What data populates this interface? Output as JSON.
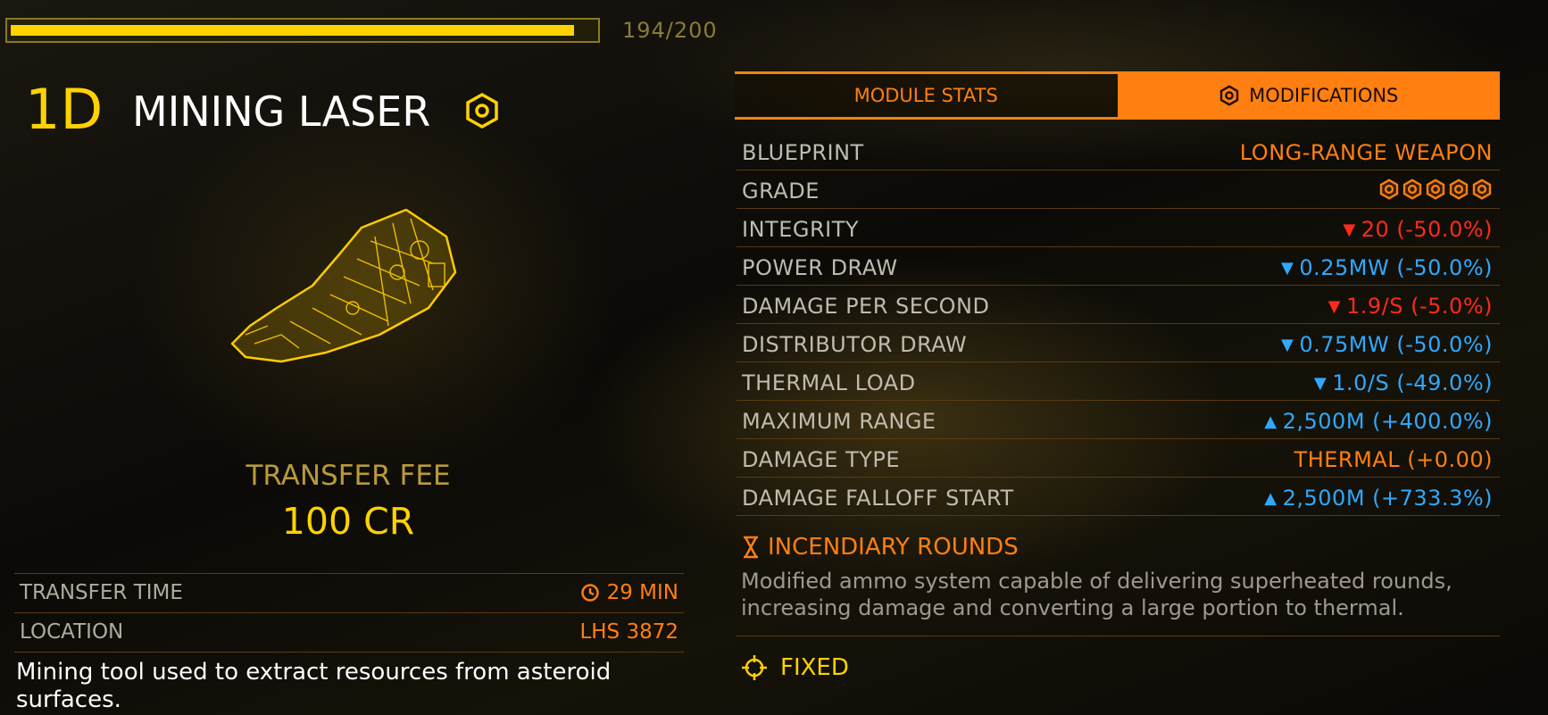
{
  "integrity_bar": {
    "value": 194,
    "max": 200,
    "label": "194/200",
    "fill_fraction": 0.97,
    "color": "#ffd200"
  },
  "module": {
    "class": "1D",
    "name": "MINING LASER",
    "engineered_icon": "engineering-hex-icon",
    "art_icon": "mining-laser-hologram"
  },
  "transfer": {
    "fee_label": "TRANSFER FEE",
    "fee_value": "100 CR",
    "rows": [
      {
        "label": "TRANSFER TIME",
        "value": "29 MIN",
        "icon": "clock-icon"
      },
      {
        "label": "LOCATION",
        "value": "LHS 3872"
      }
    ]
  },
  "description": "Mining tool used to extract resources from asteroid surfaces.",
  "tabs": [
    {
      "label": "MODULE STATS",
      "active": false
    },
    {
      "label": "MODIFICATIONS",
      "active": true,
      "icon": "engineering-hex-icon"
    }
  ],
  "stats": [
    {
      "label": "BLUEPRINT",
      "value": "LONG-RANGE WEAPON",
      "color": "orange"
    },
    {
      "label": "GRADE",
      "value": "",
      "grade": 5,
      "color": "orange"
    },
    {
      "label": "INTEGRITY",
      "value": "20 (-50.0%)",
      "arrow": "down",
      "color": "red"
    },
    {
      "label": "POWER DRAW",
      "value": "0.25MW (-50.0%)",
      "arrow": "down",
      "color": "blue"
    },
    {
      "label": "DAMAGE PER SECOND",
      "value": "1.9/S (-5.0%)",
      "arrow": "down",
      "color": "red"
    },
    {
      "label": "DISTRIBUTOR DRAW",
      "value": "0.75MW (-50.0%)",
      "arrow": "down",
      "color": "blue"
    },
    {
      "label": "THERMAL LOAD",
      "value": "1.0/S (-49.0%)",
      "arrow": "down",
      "color": "blue"
    },
    {
      "label": "MAXIMUM RANGE",
      "value": "2,500M (+400.0%)",
      "arrow": "up",
      "color": "blue"
    },
    {
      "label": "DAMAGE TYPE",
      "value": "THERMAL (+0.00)",
      "color": "orange"
    },
    {
      "label": "DAMAGE FALLOFF START",
      "value": "2,500M (+733.3%)",
      "arrow": "up",
      "color": "blue"
    }
  ],
  "special_effect": {
    "title": "INCENDIARY ROUNDS",
    "icon": "experimental-effect-icon",
    "description": "Modified ammo system capable of delivering superheated rounds, increasing damage and converting a large portion to thermal."
  },
  "mount": {
    "label": "FIXED",
    "icon": "crosshair-icon"
  },
  "colors": {
    "orange": "#ff7f10",
    "yellow": "#ffd200",
    "red": "#ff2a1a",
    "blue": "#2fa8ff"
  }
}
